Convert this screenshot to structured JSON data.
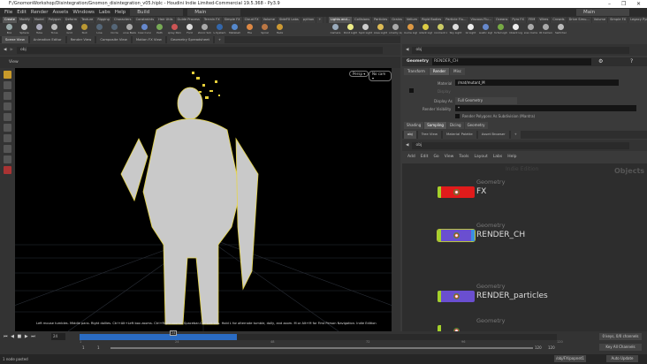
{
  "window": {
    "title": "F:/GnomonWorkshop/Disintegration/Gnomon_disintegration_v05.hiplc - Houdini Indie Limited-Commercial 19.5.368 - Py3.9",
    "minimize": "–",
    "restore": "❐",
    "close": "✕"
  },
  "menu": [
    "File",
    "Edit",
    "Render",
    "Assets",
    "Windows",
    "Labs",
    "Help"
  ],
  "desktops": {
    "left": "Build",
    "right": "Main"
  },
  "shelf_left": {
    "tabs": [
      "Create",
      "Modify",
      "Model",
      "Polygon",
      "Deform",
      "Texture",
      "Rigging",
      "Characters",
      "Constraints",
      "Hair Utils",
      "Guide Process",
      "Terrain FX",
      "Simple FX",
      "Cloud FX",
      "Volume",
      "SideFX Labs",
      "python",
      "+"
    ],
    "tools": [
      "Box",
      "Sphere",
      "Tube",
      "Torus",
      "Grid",
      "Null",
      "Line",
      "Circle",
      "Curve Bezier",
      "Draw Curve",
      "Path",
      "Spray Paint",
      "Font",
      "Platonic Solids",
      "L-System",
      "Metaball",
      "File",
      "Spiral",
      "Helix"
    ]
  },
  "shelf_right": {
    "tabs": [
      "Lights and...",
      "Collisions",
      "Particles",
      "Grains",
      "Vellum",
      "Rigid Bodies",
      "Particle Flu...",
      "Viscous Flu...",
      "Oceans",
      "Pyro FX",
      "FEM",
      "Wires",
      "Crowds",
      "Drive Simu...",
      "Volume",
      "Simple FX",
      "Legacy Pyr",
      "+"
    ],
    "tools": [
      "Camera",
      "Point Light",
      "Spot Light",
      "Area Light",
      "Geometry Light",
      "Volume Light",
      "Distant Light",
      "Environment Light",
      "Sky Light",
      "GI Light",
      "Caustic Light",
      "Portal Light",
      "Ambient Light",
      "Stereo Camera",
      "VR Camera",
      "Switcher"
    ]
  },
  "left_panetabs": [
    "Scene View",
    "Animation Editor",
    "Render View",
    "Composite View",
    "Motion FX View",
    "Geometry Spreadsheet",
    "+"
  ],
  "right_panetabs": [
    "RENDER_CH",
    "Take List",
    "Performance Monitor",
    "+"
  ],
  "viewport": {
    "path": "obj",
    "title": "View",
    "persp": "Persp ▾",
    "cam": "No cam ▾",
    "hint": "Left mouse tumbles. Middle pans. Right dollies. Ctrl+Alt+Left box zooms. Ctrl+Right zooms. Spacebar-Ctrl-Left tilts. Hold L for alternate tumble, dolly, and zoom.    M or Alt+M for First Person Navigation.  Indie Edition"
  },
  "params": {
    "path": "obj",
    "type": "Geometry",
    "name": "RENDER_CH",
    "tabs": [
      "Transform",
      "Render",
      "Misc"
    ],
    "material_label": "Material",
    "material_value": "/mat/mutant_M",
    "display_label": "Display",
    "display_as_label": "Display As",
    "display_as_value": "Full Geometry",
    "render_vis_label": "Render Visibility",
    "render_vis_value": "*",
    "subdiv_label": "Render Polygons As Subdivision (Mantra)",
    "subtabs": [
      "Shading",
      "Sampling",
      "Dicing",
      "Geometry"
    ]
  },
  "network": {
    "tabs": [
      "obj",
      "Tree View",
      "Material Palette",
      "Asset Browser",
      "+"
    ],
    "path": "obj",
    "menu": [
      "Add",
      "Edit",
      "Go",
      "View",
      "Tools",
      "Layout",
      "Labs",
      "Help"
    ],
    "watermark": "Indie Edition",
    "context": "Objects",
    "nodes": [
      {
        "type": "Geometry",
        "name": "FX",
        "color": "#e01b1b"
      },
      {
        "type": "Geometry",
        "name": "RENDER_CH",
        "color": "#6a4fd0"
      },
      {
        "type": "Geometry",
        "name": "RENDER_particles",
        "color": "#6a4fd0"
      },
      {
        "type": "Geometry",
        "name": ""
      }
    ]
  },
  "timeline": {
    "frame": "24",
    "marker": "24",
    "ticks": [
      "1",
      "24",
      "48",
      "72",
      "96",
      "120"
    ],
    "start": "1",
    "start2": "1",
    "end": "120",
    "end2": "120",
    "progress": 0.33,
    "keys": "0 keys, 0/0 channels",
    "key_all": "Key All Channels"
  },
  "status": {
    "message": "1 node pasted",
    "node_path": "/obj/FX/popnet1",
    "auto_update": "Auto Update"
  }
}
